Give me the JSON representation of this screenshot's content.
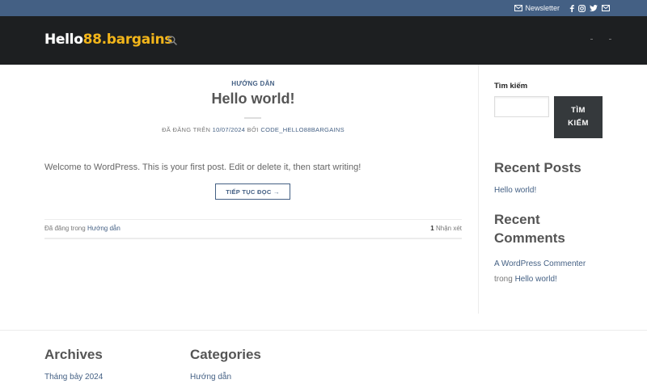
{
  "topbar": {
    "newsletter_label": "Newsletter",
    "icons": [
      "mail-icon",
      "facebook-icon",
      "instagram-icon",
      "twitter-icon",
      "envelope-icon"
    ],
    "background": "#446084"
  },
  "header": {
    "logo_white": "Hello",
    "logo_yellow": "88.bargains",
    "background": "#1d1f21",
    "logo_accent": "#f2b51a"
  },
  "post": {
    "category": "HƯỚNG DẪN",
    "title": "Hello world!",
    "meta_posted": "ĐÃ ĐĂNG TRÊN",
    "meta_date": "10/07/2024",
    "meta_by": "BỞI",
    "meta_author": "CODE_HELLO88BARGAINS",
    "excerpt": "Welcome to WordPress. This is your first post. Edit or delete it, then start writing!",
    "read_more": "TIẾP TỤC ĐỌC →",
    "footer_posted_in": "Đã đăng trong",
    "footer_category": "Hướng dẫn",
    "comment_count": "1",
    "comment_label": "Nhận xét"
  },
  "sidebar": {
    "search_label": "Tìm kiếm",
    "search_placeholder": "",
    "search_button_line1": "TÌM",
    "search_button_line2": "KIẾM",
    "recent_posts_title": "Recent Posts",
    "recent_posts": [
      "Hello world!"
    ],
    "recent_comments_title_line1": "Recent",
    "recent_comments_title_line2": "Comments",
    "comment_author": "A WordPress Commenter",
    "comment_on": "trong",
    "comment_post": "Hello world!"
  },
  "footer": {
    "archives_title": "Archives",
    "archives_items": [
      "Tháng bảy 2024"
    ],
    "categories_title": "Categories",
    "categories_items": [
      "Hướng dẫn"
    ]
  },
  "colors": {
    "primary": "#446084",
    "button_dark": "#35393c",
    "heading": "#555555"
  }
}
